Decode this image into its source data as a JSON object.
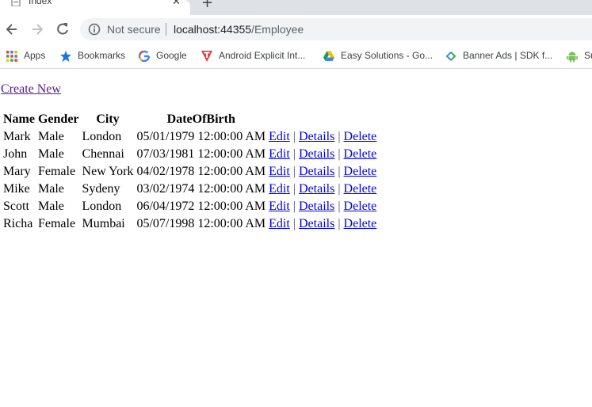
{
  "browser": {
    "tab_title": "Index",
    "address": {
      "security_label": "Not secure",
      "host": "localhost:44355",
      "path": "/Employee"
    },
    "bookmarks": [
      {
        "label": "Apps",
        "icon": "apps-grid-icon"
      },
      {
        "label": "Bookmarks",
        "icon": "star-icon"
      },
      {
        "label": "Google",
        "icon": "google-icon"
      },
      {
        "label": "Android Explicit Int...",
        "icon": "android-explicit-icon"
      },
      {
        "label": "Easy Solutions - Go...",
        "icon": "google-drive-icon"
      },
      {
        "label": "Banner Ads  |  SDK f...",
        "icon": "admob-icon"
      },
      {
        "label": "Su",
        "icon": "android-icon"
      }
    ]
  },
  "page": {
    "create_new": "Create New",
    "table": {
      "headers": [
        "Name",
        "Gender",
        "City",
        "DateOfBirth"
      ],
      "action_labels": {
        "edit": "Edit",
        "details": "Details",
        "delete": "Delete",
        "separator": "|"
      },
      "rows": [
        {
          "name": "Mark",
          "gender": "Male",
          "city": "London",
          "dob": "05/01/1979 12:00:00 AM"
        },
        {
          "name": "John",
          "gender": "Male",
          "city": "Chennai",
          "dob": "07/03/1981 12:00:00 AM"
        },
        {
          "name": "Mary",
          "gender": "Female",
          "city": "New York",
          "dob": "04/02/1978 12:00:00 AM"
        },
        {
          "name": "Mike",
          "gender": "Male",
          "city": "Sydeny",
          "dob": "03/02/1974 12:00:00 AM"
        },
        {
          "name": "Scott",
          "gender": "Male",
          "city": "London",
          "dob": "06/04/1972 12:00:00 AM"
        },
        {
          "name": "Richa",
          "gender": "Female",
          "city": "Mumbai",
          "dob": "05/07/1998 12:00:00 AM"
        }
      ]
    }
  }
}
